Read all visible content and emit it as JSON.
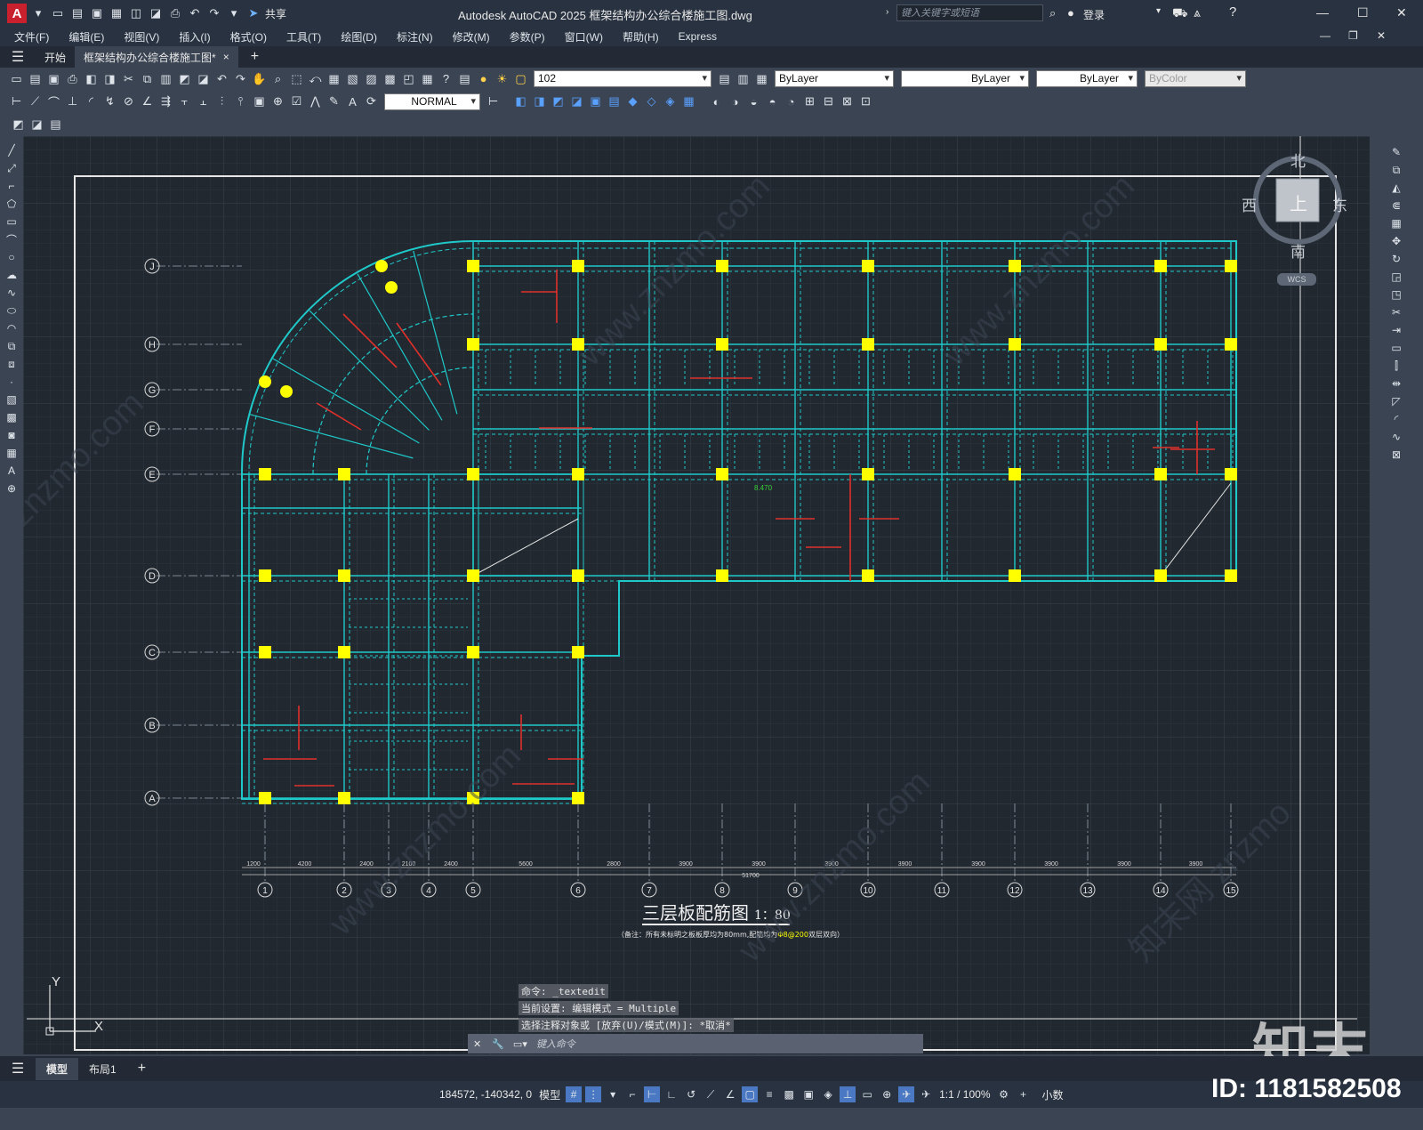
{
  "app": {
    "logo": "A",
    "title": "Autodesk AutoCAD 2025    框架结构办公综合楼施工图.dwg",
    "share_label": "共享",
    "search_placeholder": "键入关键字或短语",
    "login_label": "登录"
  },
  "menu": [
    "文件(F)",
    "编辑(E)",
    "视图(V)",
    "插入(I)",
    "格式(O)",
    "工具(T)",
    "绘图(D)",
    "标注(N)",
    "修改(M)",
    "参数(P)",
    "窗口(W)",
    "帮助(H)",
    "Express"
  ],
  "tabs": {
    "start": "开始",
    "doc": "框架结构办公综合楼施工图*",
    "close": "×",
    "add": "+"
  },
  "toolbar": {
    "layer_value": "102",
    "color_value": "ByLayer",
    "linetype_value": "ByLayer",
    "lineweight_value": "ByLayer",
    "plotstyle_value": "ByColor",
    "dimstyle_value": "NORMAL"
  },
  "viewcube": {
    "north": "北",
    "south": "南",
    "east": "东",
    "west": "西",
    "top": "上",
    "wcs": "WCS"
  },
  "drawing": {
    "title": "三层板配筋图",
    "scale": "1：80",
    "note_prefix": "（备注：所有未标明之板板厚均为80mm,配筋均为",
    "note_highlight": "Φ8@200",
    "note_suffix": "双层双向）",
    "axis_rows": [
      "J",
      "H",
      "G",
      "F",
      "E",
      "D",
      "C",
      "B",
      "A"
    ],
    "axis_cols": [
      "1",
      "2",
      "3",
      "4",
      "5",
      "6",
      "7",
      "8",
      "9",
      "10",
      "11",
      "12",
      "13",
      "14",
      "15"
    ],
    "bottom_dims": [
      "1200",
      "4200",
      "2400",
      "2100",
      "2400",
      "5600",
      "2800",
      "3900",
      "3900",
      "3900",
      "3900",
      "3900",
      "3900",
      "3900",
      "3900"
    ],
    "total_dim": "51700",
    "elevation": "8.470"
  },
  "ucs": {
    "y": "Y",
    "x": "X"
  },
  "command": {
    "history": [
      "命令: _textedit",
      "当前设置: 编辑模式 = Multiple",
      "选择注释对象或 [放弃(U)/模式(M)]: *取消*"
    ],
    "placeholder": "键入命令"
  },
  "layout": {
    "model": "模型",
    "layout1": "布局1",
    "add": "+"
  },
  "status": {
    "coords": "184572, -140342, 0",
    "model": "模型",
    "scale": "1:1 / 100%",
    "units": "小数"
  },
  "watermark": {
    "brand": "知末",
    "id": "ID: 1181582508"
  }
}
